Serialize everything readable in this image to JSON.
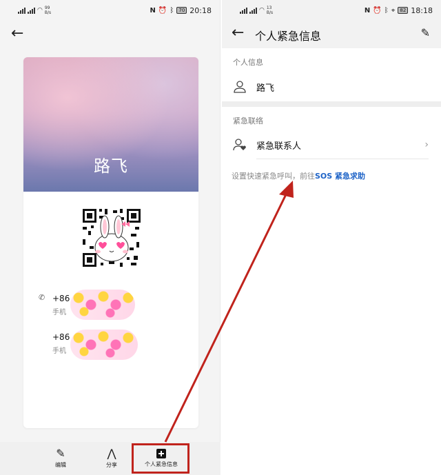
{
  "left_phone": {
    "status": {
      "net_speed_value": "99",
      "net_speed_unit": "B/s",
      "battery": "70",
      "time": "20:18"
    },
    "card": {
      "name": "路飞"
    },
    "contacts": [
      {
        "number": "+86",
        "type": "手机"
      },
      {
        "number": "+86",
        "type": "手机"
      }
    ],
    "bottom_bar": {
      "edit": "编辑",
      "share": "分享",
      "emergency_info": "个人紧急信息"
    }
  },
  "right_phone": {
    "status": {
      "net_speed_value": "13",
      "net_speed_unit": "B/s",
      "battery": "82",
      "time": "18:18"
    },
    "title": "个人紧急信息",
    "personal_section": {
      "label": "个人信息",
      "name": "路飞"
    },
    "contacts_section": {
      "label": "紧急联络",
      "item": "紧急联系人"
    },
    "hint": {
      "prefix": "设置快速紧急呼叫，前往",
      "link": "SOS 紧急求助"
    }
  },
  "annotation": {
    "color": "#c0231c"
  }
}
